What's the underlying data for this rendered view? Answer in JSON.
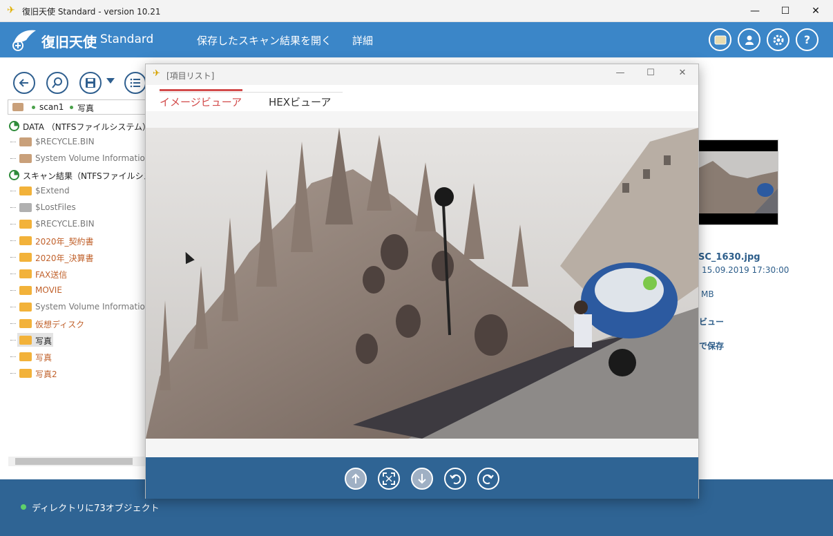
{
  "window": {
    "title": "復旧天使 Standard - version 10.21",
    "controls": [
      "—",
      "☐",
      "✕"
    ]
  },
  "header": {
    "brand": "復旧天使",
    "brand_sub": "Standard",
    "menu": [
      "保存したスキャン結果を開く",
      "詳細"
    ],
    "icons": [
      "list-icon",
      "user-icon",
      "gear-icon",
      "help-icon"
    ]
  },
  "toolbar": {
    "buttons": [
      "back-icon",
      "search-icon",
      "save-icon",
      "list-icon"
    ]
  },
  "path": {
    "items": [
      "scan1",
      "写真"
    ]
  },
  "tree": {
    "drive1": "DATA （NTFSファイルシステム）",
    "drive1_children": [
      "$RECYCLE.BIN",
      "System Volume Information"
    ],
    "drive2": "スキャン結果（NTFSファイルシステム）",
    "drive2_children": [
      "$Extend",
      "$LostFiles",
      "$RECYCLE.BIN",
      "2020年_契約書",
      "2020年_決算書",
      "FAX送信",
      "MOVIE",
      "System Volume Information",
      "仮想ディスク",
      "写真",
      "写真",
      "写真2"
    ]
  },
  "right_panel": {
    "file_name": "SC_1630.jpg",
    "date": "15.09.2019 17:30:00",
    "size_unit": "MB",
    "preview_link": "ビュー",
    "save_link": "で保存"
  },
  "status": {
    "text": "ディレクトリに73オブジェクト"
  },
  "popup": {
    "title": "[項目リスト]",
    "tabs": [
      "イメージビューア",
      "HEXビューア"
    ],
    "active_tab": 0,
    "nav_buttons": [
      "up-arrow-icon",
      "fit-screen-icon",
      "down-arrow-icon",
      "rotate-left-icon",
      "rotate-right-icon"
    ]
  }
}
